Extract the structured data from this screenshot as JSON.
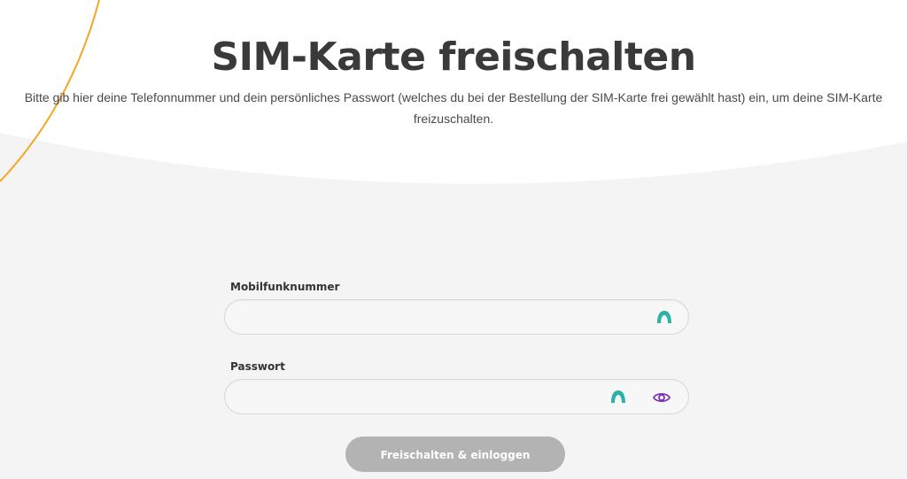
{
  "header": {
    "title": "SIM-Karte freischalten",
    "subtitle": "Bitte gib hier deine Telefonnummer und dein persönliches Passwort (welches du bei der Bestellung der SIM-Karte frei gewählt hast) ein, um deine SIM-Karte freizuschalten."
  },
  "form": {
    "phone": {
      "label": "Mobilfunknummer",
      "value": "",
      "placeholder": ""
    },
    "password": {
      "label": "Passwort",
      "value": "",
      "placeholder": ""
    },
    "submit_label": "Freischalten & einloggen"
  },
  "icons": {
    "autofill": "autofill-key-icon",
    "password_visibility": "eye-icon"
  },
  "colors": {
    "accent_orange": "#f5a623",
    "autofill_teal": "#2bb3a8",
    "eye_purple": "#7b2fbe",
    "button_disabled": "#b3b3b3",
    "title": "#3a3a3a"
  }
}
